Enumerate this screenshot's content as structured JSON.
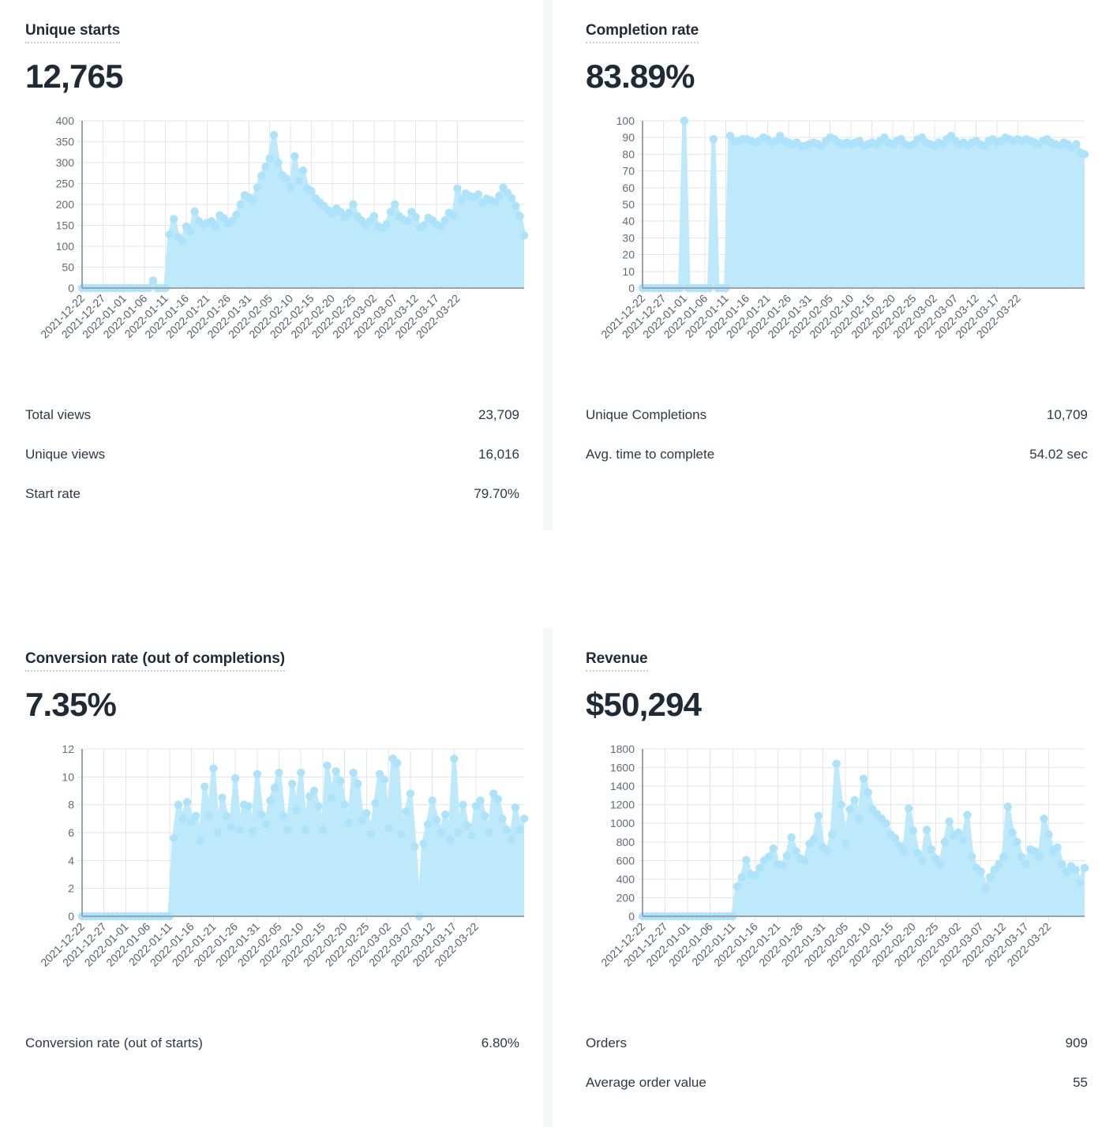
{
  "theme": {
    "series_fill": "#bde9fb",
    "series_marker": "#ade3fa",
    "grid_line": "#e3e6e9",
    "axis_line": "#9aa2ab",
    "text_dark": "#1f2a37",
    "text_body": "#2e3843",
    "tick_text": "#636b75",
    "divider": "#f4f6f8",
    "background": "#ffffff"
  },
  "panels": {
    "unique_starts": {
      "title": "Unique starts",
      "value": "12,765",
      "stats": [
        {
          "label": "Total views",
          "value": "23,709"
        },
        {
          "label": "Unique views",
          "value": "16,016"
        },
        {
          "label": "Start rate",
          "value": "79.70%"
        }
      ]
    },
    "completion_rate": {
      "title": "Completion rate",
      "value": "83.89%",
      "stats": [
        {
          "label": "Unique Completions",
          "value": "10,709"
        },
        {
          "label": "Avg. time to complete",
          "value": "54.02 sec"
        }
      ]
    },
    "conversion_rate": {
      "title": "Conversion rate (out of completions)",
      "value": "7.35%",
      "stats": [
        {
          "label": "Conversion rate (out of starts)",
          "value": "6.80%"
        }
      ]
    },
    "revenue": {
      "title": "Revenue",
      "value": "$50,294",
      "stats": [
        {
          "label": "Orders",
          "value": "909"
        },
        {
          "label": "Average order value",
          "value": "55"
        }
      ]
    }
  },
  "chart_data": [
    {
      "id": "unique_starts",
      "type": "area",
      "title": "Unique starts",
      "xlabel": "",
      "ylabel": "",
      "ylim": [
        0,
        400
      ],
      "yticks": [
        0,
        50,
        100,
        150,
        200,
        250,
        300,
        350,
        400
      ],
      "grid": true,
      "legend": "none",
      "markers": true,
      "x_tick_labels": [
        "2021-12-22",
        "2021-12-27",
        "2022-01-01",
        "2022-01-06",
        "2022-01-11",
        "2022-01-16",
        "2022-01-21",
        "2022-01-26",
        "2022-01-31",
        "2022-02-05",
        "2022-02-10",
        "2022-02-15",
        "2022-02-20",
        "2022-02-25",
        "2022-03-02",
        "2022-03-07",
        "2022-03-12",
        "2022-03-17",
        "2022-03-22"
      ],
      "x_start": "2021-12-22",
      "x_end": "2022-03-22",
      "x_tick_step_days": 5,
      "values": [
        0,
        0,
        0,
        0,
        0,
        0,
        0,
        0,
        0,
        0,
        0,
        0,
        0,
        0,
        0,
        0,
        0,
        18,
        0,
        0,
        0,
        128,
        165,
        122,
        112,
        147,
        135,
        183,
        160,
        152,
        156,
        160,
        148,
        174,
        167,
        154,
        161,
        175,
        200,
        222,
        217,
        210,
        240,
        268,
        290,
        310,
        366,
        300,
        270,
        262,
        241,
        315,
        256,
        281,
        238,
        232,
        214,
        205,
        196,
        186,
        178,
        190,
        182,
        170,
        180,
        200,
        172,
        162,
        150,
        160,
        172,
        148,
        143,
        153,
        182,
        200,
        172,
        164,
        160,
        182,
        170,
        144,
        150,
        168,
        162,
        152,
        148,
        162,
        180,
        172,
        238,
        210,
        226,
        220,
        218,
        224,
        204,
        214,
        210,
        206,
        220,
        240,
        228,
        215,
        196,
        172,
        126
      ]
    },
    {
      "id": "completion_rate",
      "type": "area",
      "title": "Completion rate",
      "xlabel": "",
      "ylabel": "",
      "ylim": [
        0,
        100
      ],
      "yticks": [
        0,
        10,
        20,
        30,
        40,
        50,
        60,
        70,
        80,
        90,
        100
      ],
      "grid": true,
      "legend": "none",
      "markers": true,
      "x_tick_labels": [
        "2021-12-22",
        "2021-12-27",
        "2022-01-01",
        "2022-01-06",
        "2022-01-11",
        "2022-01-16",
        "2022-01-21",
        "2022-01-26",
        "2022-01-31",
        "2022-02-05",
        "2022-02-10",
        "2022-02-15",
        "2022-02-20",
        "2022-02-25",
        "2022-03-02",
        "2022-03-07",
        "2022-03-12",
        "2022-03-17",
        "2022-03-22"
      ],
      "x_start": "2021-12-22",
      "x_end": "2022-03-22",
      "x_tick_step_days": 5,
      "values": [
        0,
        0,
        0,
        0,
        0,
        0,
        0,
        0,
        0,
        0,
        100,
        0,
        0,
        0,
        0,
        0,
        0,
        89,
        0,
        0,
        0,
        91,
        88,
        88,
        89,
        89,
        88,
        87,
        88,
        90,
        89,
        87,
        88,
        91,
        88,
        87,
        86,
        87,
        85,
        85,
        86,
        87,
        86,
        85,
        88,
        90,
        89,
        87,
        86,
        87,
        86,
        87,
        88,
        85,
        86,
        87,
        86,
        88,
        90,
        87,
        86,
        88,
        89,
        86,
        85,
        86,
        89,
        90,
        87,
        86,
        85,
        87,
        86,
        89,
        91,
        88,
        86,
        87,
        85,
        87,
        88,
        86,
        85,
        88,
        89,
        87,
        88,
        90,
        89,
        88,
        89,
        88,
        89,
        88,
        87,
        86,
        88,
        89,
        87,
        86,
        85,
        87,
        86,
        84,
        86,
        81,
        80
      ]
    },
    {
      "id": "conversion_rate",
      "type": "area",
      "title": "Conversion rate (out of completions)",
      "xlabel": "",
      "ylabel": "",
      "ylim": [
        0,
        12
      ],
      "yticks": [
        0,
        2,
        4,
        6,
        8,
        10,
        12
      ],
      "grid": true,
      "legend": "none",
      "markers": true,
      "x_tick_labels": [
        "2021-12-22",
        "2021-12-27",
        "2022-01-01",
        "2022-01-06",
        "2022-01-11",
        "2022-01-16",
        "2022-01-21",
        "2022-01-26",
        "2022-01-31",
        "2022-02-05",
        "2022-02-10",
        "2022-02-15",
        "2022-02-20",
        "2022-02-25",
        "2022-03-02",
        "2022-03-07",
        "2022-03-12",
        "2022-03-17",
        "2022-03-22"
      ],
      "x_start": "2021-12-22",
      "x_end": "2022-03-22",
      "x_tick_step_days": 5,
      "values": [
        0,
        0,
        0,
        0,
        0,
        0,
        0,
        0,
        0,
        0,
        0,
        0,
        0,
        0,
        0,
        0,
        0,
        0,
        0,
        0,
        0,
        5.6,
        8.0,
        7.0,
        8.2,
        6.8,
        7.2,
        5.4,
        9.3,
        7.2,
        10.6,
        6.0,
        8.5,
        7.2,
        6.4,
        9.9,
        6.2,
        8.0,
        7.9,
        6.1,
        10.2,
        7.3,
        6.6,
        8.3,
        9.2,
        10.3,
        7.2,
        6.2,
        9.5,
        7.6,
        10.3,
        6.2,
        8.6,
        9.0,
        7.9,
        6.2,
        10.8,
        8.5,
        10.4,
        9.7,
        8.0,
        6.7,
        10.3,
        9.5,
        6.9,
        7.4,
        5.9,
        8.1,
        10.2,
        9.8,
        6.3,
        11.3,
        11.0,
        5.9,
        7.5,
        8.8,
        5.0,
        0.0,
        5.2,
        6.6,
        8.3,
        6.9,
        6.0,
        7.3,
        5.5,
        11.3,
        6.0,
        8.0,
        6.5,
        5.8,
        7.9,
        8.3,
        7.2,
        6.0,
        8.8,
        8.4,
        7.0,
        6.2,
        5.5,
        7.8,
        6.2,
        7.0
      ]
    },
    {
      "id": "revenue",
      "type": "area",
      "title": "Revenue",
      "xlabel": "",
      "ylabel": "",
      "ylim": [
        0,
        1800
      ],
      "yticks": [
        0,
        200,
        400,
        600,
        800,
        1000,
        1200,
        1400,
        1600,
        1800
      ],
      "grid": true,
      "legend": "none",
      "markers": true,
      "x_tick_labels": [
        "2021-12-22",
        "2021-12-27",
        "2022-01-01",
        "2022-01-06",
        "2022-01-11",
        "2022-01-16",
        "2022-01-21",
        "2022-01-26",
        "2022-01-31",
        "2022-02-05",
        "2022-02-10",
        "2022-02-15",
        "2022-02-20",
        "2022-02-25",
        "2022-03-02",
        "2022-03-07",
        "2022-03-12",
        "2022-03-17",
        "2022-03-22"
      ],
      "x_start": "2021-12-22",
      "x_end": "2022-03-22",
      "x_tick_step_days": 5,
      "values": [
        0,
        0,
        0,
        0,
        0,
        0,
        0,
        0,
        0,
        0,
        0,
        0,
        0,
        0,
        0,
        0,
        0,
        0,
        0,
        0,
        0,
        320,
        420,
        605,
        450,
        440,
        520,
        600,
        640,
        730,
        560,
        550,
        650,
        850,
        700,
        620,
        600,
        780,
        830,
        1080,
        740,
        700,
        880,
        1640,
        1200,
        780,
        1150,
        1250,
        1050,
        1480,
        1330,
        1150,
        1100,
        1050,
        1000,
        880,
        840,
        760,
        700,
        1160,
        920,
        680,
        600,
        930,
        720,
        620,
        560,
        800,
        1020,
        870,
        900,
        820,
        1090,
        640,
        520,
        480,
        300,
        420,
        500,
        560,
        640,
        1180,
        900,
        800,
        640,
        560,
        720,
        700,
        640,
        1050,
        880,
        700,
        740,
        560,
        480,
        540,
        500,
        360,
        520
      ]
    }
  ]
}
